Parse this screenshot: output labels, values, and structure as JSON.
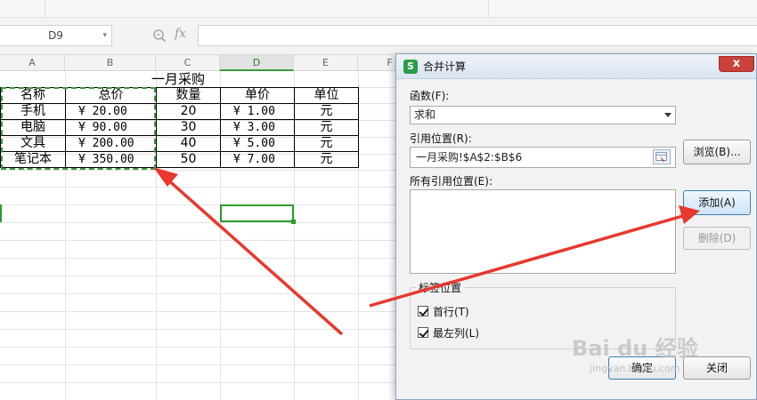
{
  "namebox": {
    "value": "D9"
  },
  "formula": {
    "fx_label": "fx",
    "value": ""
  },
  "columns": [
    "A",
    "B",
    "C",
    "D",
    "E",
    "F"
  ],
  "active_column": "D",
  "sheet": {
    "title": "一月采购",
    "headers": [
      "名称",
      "总价",
      "数量",
      "单价",
      "单位"
    ],
    "rows": [
      {
        "name": "手机",
        "total": "¥   20.00",
        "qty": "20",
        "price": "¥  1.00",
        "unit": "元"
      },
      {
        "name": "电脑",
        "total": "¥   90.00",
        "qty": "30",
        "price": "¥  3.00",
        "unit": "元"
      },
      {
        "name": "文具",
        "total": "¥  200.00",
        "qty": "40",
        "price": "¥  5.00",
        "unit": "元"
      },
      {
        "name": "笔记本",
        "total": "¥  350.00",
        "qty": "50",
        "price": "¥  7.00",
        "unit": "元"
      }
    ]
  },
  "dialog": {
    "app_icon": "S",
    "title": "合并计算",
    "close_label": "x",
    "function_label": "函数(F):",
    "function_value": "求和",
    "reference_label": "引用位置(R):",
    "reference_value": "一月采购!$A$2:$B$6",
    "browse_label": "浏览(B)...",
    "all_refs_label": "所有引用位置(E):",
    "add_label": "添加(A)",
    "delete_label": "删除(D)",
    "label_group": "标签位置",
    "first_row_label": "首行(T)",
    "left_column_label": "最左列(L)",
    "ok_label": "确定",
    "close_button_label": "关闭"
  },
  "watermark": {
    "brand": "Bai du 经验",
    "url": "jingyan.baidu.com"
  },
  "colors": {
    "marquee": "#3b9a3b",
    "arrow": "#e8382e",
    "close": "#c9413a"
  }
}
